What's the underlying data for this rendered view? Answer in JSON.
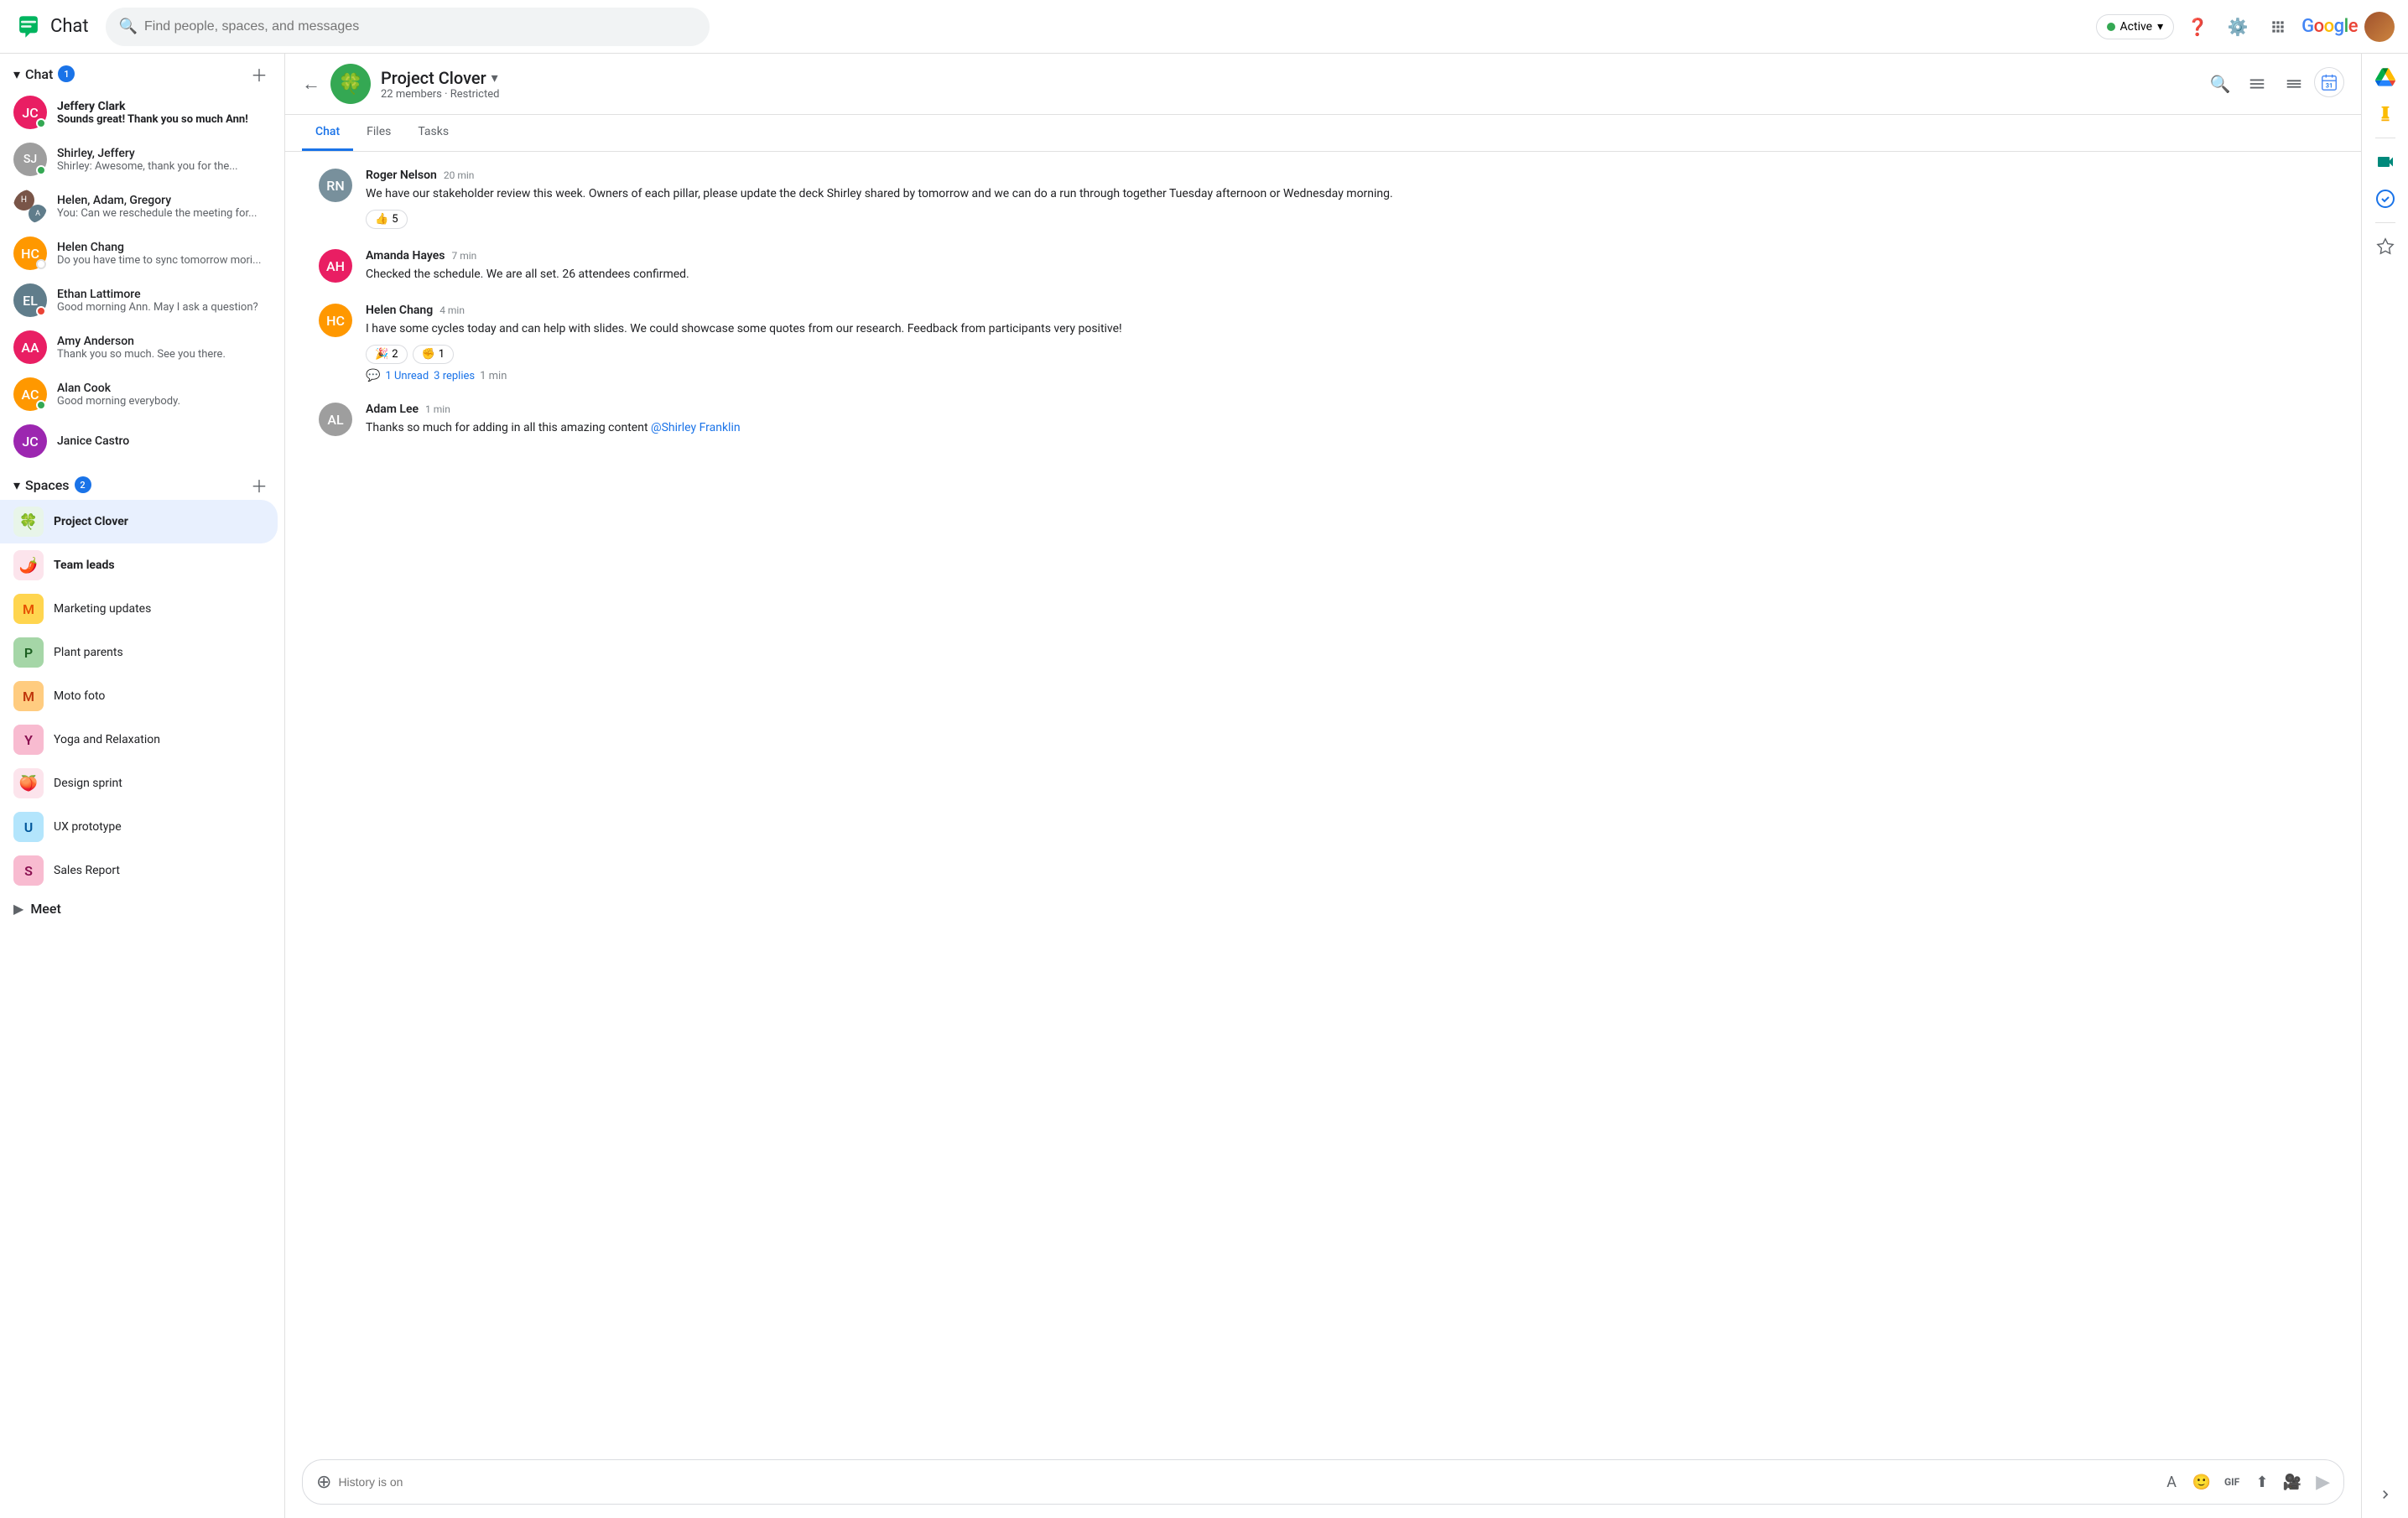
{
  "topbar": {
    "app_name": "Chat",
    "search_placeholder": "Find people, spaces, and messages",
    "active_label": "Active",
    "active_dropdown": "▾",
    "google_text": "Google"
  },
  "sidebar": {
    "chat_section_label": "Chat",
    "chat_badge": "1",
    "spaces_section_label": "Spaces",
    "spaces_badge": "2",
    "meet_section_label": "Meet",
    "chat_items": [
      {
        "id": "jeffery",
        "name": "Jeffery Clark",
        "preview": "Sounds great! Thank you so much Ann!",
        "bold": true,
        "color": "#e91e63",
        "initials": "JC",
        "status": "green"
      },
      {
        "id": "shirley-jeffery",
        "name": "Shirley, Jeffery",
        "preview": "Shirley: Awesome, thank you for the...",
        "bold": false,
        "color": "#9e9e9e",
        "initials": "SJ",
        "status": "green"
      },
      {
        "id": "helen-adam",
        "name": "Helen, Adam, Gregory",
        "preview": "You: Can we reschedule the meeting for...",
        "bold": false,
        "color": "#795548",
        "initials": "H",
        "status": null
      },
      {
        "id": "helen-chang",
        "name": "Helen Chang",
        "preview": "Do you have time to sync tomorrow mori...",
        "bold": false,
        "color": "#ff9800",
        "initials": "HC",
        "status": "white"
      },
      {
        "id": "ethan",
        "name": "Ethan Lattimore",
        "preview": "Good morning Ann. May I ask a question?",
        "bold": false,
        "color": "#607d8b",
        "initials": "EL",
        "status": "red"
      },
      {
        "id": "amy",
        "name": "Amy Anderson",
        "preview": "Thank you so much. See you there.",
        "bold": false,
        "color": "#e91e63",
        "initials": "AA",
        "status": null
      },
      {
        "id": "alan",
        "name": "Alan Cook",
        "preview": "Good morning everybody.",
        "bold": false,
        "color": "#ff9800",
        "initials": "AC",
        "status": "green"
      },
      {
        "id": "janice",
        "name": "Janice Castro",
        "preview": "",
        "bold": false,
        "color": "#9c27b0",
        "initials": "JC2",
        "status": null
      }
    ],
    "spaces_items": [
      {
        "id": "project-clover",
        "name": "Project Clover",
        "icon": "🍀",
        "bg": "#e8f5e9",
        "bold": true,
        "active": true
      },
      {
        "id": "team-leads",
        "name": "Team leads",
        "icon": "🌶️",
        "bg": "#fce4ec",
        "bold": true,
        "active": false
      },
      {
        "id": "marketing",
        "name": "Marketing updates",
        "initial": "M",
        "bg": "#ffd54f",
        "color": "#e65100",
        "bold": false,
        "active": false
      },
      {
        "id": "plant-parents",
        "name": "Plant parents",
        "initial": "P",
        "bg": "#a5d6a7",
        "color": "#1b5e20",
        "bold": false,
        "active": false
      },
      {
        "id": "moto-foto",
        "name": "Moto foto",
        "initial": "M",
        "bg": "#ffcc80",
        "color": "#bf360c",
        "bold": false,
        "active": false
      },
      {
        "id": "yoga",
        "name": "Yoga and Relaxation",
        "initial": "Y",
        "bg": "#f8bbd0",
        "color": "#880e4f",
        "bold": false,
        "active": false
      },
      {
        "id": "design-sprint",
        "name": "Design sprint",
        "icon": "🍑",
        "bg": "#fce4ec",
        "bold": false,
        "active": false
      },
      {
        "id": "ux-prototype",
        "name": "UX prototype",
        "initial": "U",
        "bg": "#b3e5fc",
        "color": "#01579b",
        "bold": false,
        "active": false
      },
      {
        "id": "sales-report",
        "name": "Sales Report",
        "initial": "S",
        "bg": "#f8bbd0",
        "color": "#880e4f",
        "bold": false,
        "active": false
      }
    ]
  },
  "chat_header": {
    "space_name": "Project Clover",
    "members": "22 members",
    "restricted": "Restricted",
    "meta_separator": " · "
  },
  "tabs": [
    "Chat",
    "Files",
    "Tasks"
  ],
  "active_tab": "Chat",
  "messages": [
    {
      "id": "msg1",
      "sender": "Roger Nelson",
      "time": "20 min",
      "text": "We have our stakeholder review this week.  Owners of each pillar, please update the deck Shirley shared by tomorrow and we can do a run through together Tuesday afternoon or Wednesday morning.",
      "avatar_color": "#78909c",
      "initials": "RN",
      "reactions": [
        {
          "emoji": "👍",
          "count": "5"
        }
      ],
      "thread": null
    },
    {
      "id": "msg2",
      "sender": "Amanda Hayes",
      "time": "7 min",
      "text": "Checked the schedule.  We are all set.  26 attendees confirmed.",
      "avatar_color": "#e91e63",
      "initials": "AH",
      "reactions": [],
      "thread": null
    },
    {
      "id": "msg3",
      "sender": "Helen Chang",
      "time": "4 min",
      "text": "I have some cycles today and can help with slides.  We could showcase some quotes from our research.  Feedback from participants very positive!",
      "avatar_color": "#ff9800",
      "initials": "HC",
      "reactions": [
        {
          "emoji": "🎉",
          "count": "2"
        },
        {
          "emoji": "✊",
          "count": "1"
        }
      ],
      "thread": {
        "unread": "1 Unread",
        "replies": "3 replies",
        "time": "1 min"
      }
    },
    {
      "id": "msg4",
      "sender": "Adam Lee",
      "time": "1 min",
      "text": "Thanks so much for adding in all this amazing content ",
      "mention": "@Shirley Franklin",
      "avatar_color": "#9e9e9e",
      "initials": "AL",
      "reactions": [],
      "thread": null
    }
  ],
  "input": {
    "placeholder": "History is on"
  },
  "right_rail": {
    "icons": [
      "drive",
      "keep",
      "meet",
      "tasks",
      "star"
    ]
  }
}
